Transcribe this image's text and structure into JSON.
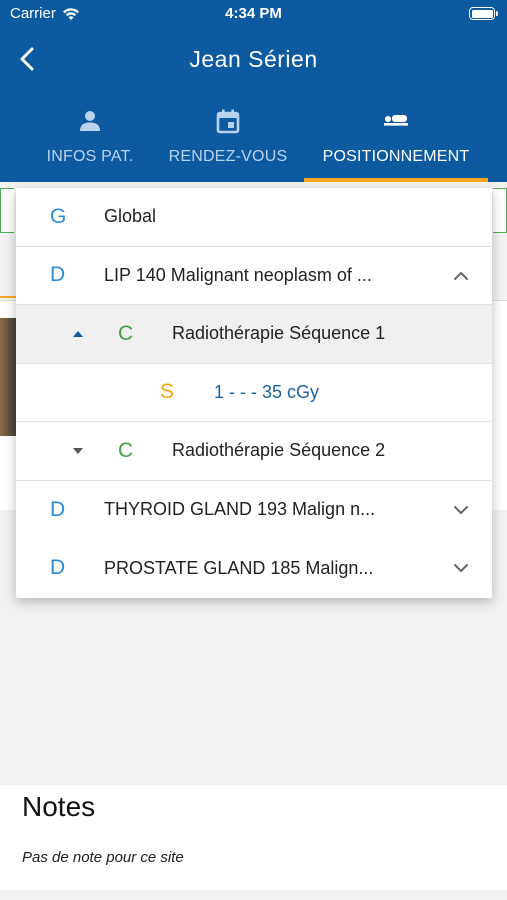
{
  "status_bar": {
    "carrier": "Carrier",
    "time": "4:34 PM"
  },
  "nav": {
    "title": "Jean Sérien"
  },
  "tabs": [
    {
      "label": "INFOS PAT.",
      "icon": "person-icon",
      "active": false
    },
    {
      "label": "RENDEZ-VOUS",
      "icon": "calendar-icon",
      "active": false
    },
    {
      "label": "POSITIONNEMENT",
      "icon": "bed-icon",
      "active": true
    }
  ],
  "dropdown": {
    "rows": [
      {
        "letter": "G",
        "label": "Global"
      },
      {
        "letter": "D",
        "label": "LIP 140 Malignant neoplasm of ...",
        "expanded": true
      },
      {
        "letter": "C",
        "label": "Radiothérapie Séquence 1",
        "expanded": true
      },
      {
        "letter": "S",
        "label": "1 - - - 35 cGy"
      },
      {
        "letter": "C",
        "label": "Radiothérapie Séquence 2",
        "expanded": false
      },
      {
        "letter": "D",
        "label": "THYROID GLAND 193 Malign n...",
        "expanded": false
      },
      {
        "letter": "D",
        "label": "PROSTATE GLAND 185 Malign...",
        "expanded": false
      }
    ]
  },
  "notes": {
    "title": "Notes",
    "text": "Pas de note pour ce site"
  },
  "colors": {
    "header": "#0d5aa0",
    "accent": "#f5a623",
    "blue_letter": "#2e8bd8",
    "green_letter": "#43a047",
    "orange_letter": "#f0a30a"
  }
}
